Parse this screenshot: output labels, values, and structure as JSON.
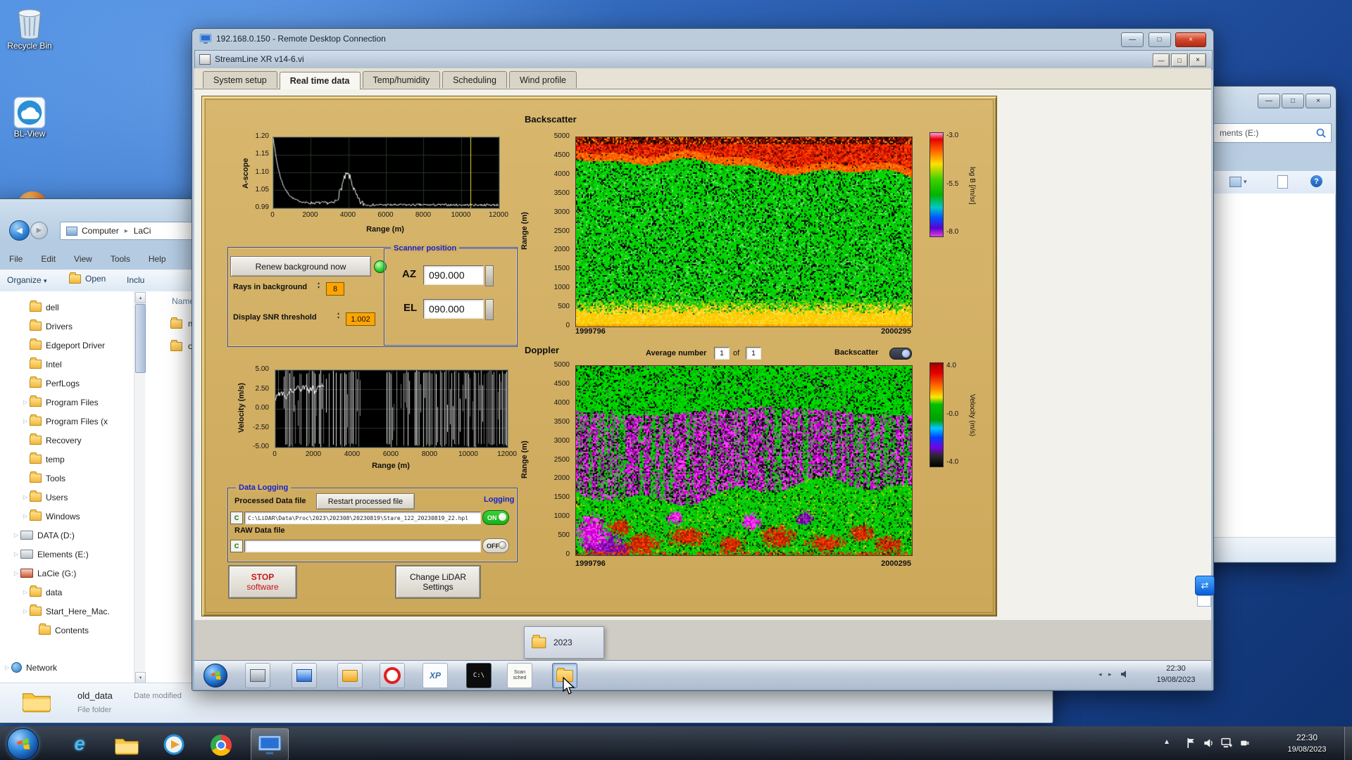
{
  "icons": {
    "close": "×",
    "minimize": "—",
    "maximize": "□",
    "back": "◀",
    "forward": "▶",
    "dropdown": "▾",
    "expand": "▷",
    "breadcrumb_sep": "▸",
    "up_chevron": "▲",
    "left_small": "◂",
    "right_small": "▸",
    "help": "?",
    "spin_up": "▴",
    "spin_down": "▾",
    "swap_arrows": "⇄"
  },
  "colors": {
    "panel_gold": "#d2af62",
    "label_blue": "#1822c8",
    "stop_red": "#c81616",
    "led_green": "#2ecc2e",
    "on_toggle": "#18b018",
    "backscatter_colorbar": [
      "#ff9ce6 0%",
      "#e80000 6%",
      "#ff6a00 18%",
      "#ffe000 30%",
      "#3ed000 45%",
      "#00b400 60%",
      "#00c8c8 72%",
      "#0054ff 82%",
      "#5a00d0 92%",
      "#e040e0 100%"
    ],
    "doppler_colorbar": [
      "#a00000 0%",
      "#e80000 10%",
      "#ff8800 25%",
      "#ffe800 33%",
      "#00c000 40%",
      "#00a000 55%",
      "#00c8ff 63%",
      "#0040ff 72%",
      "#7800e0 82%",
      "#282828 90%",
      "#000000 100%"
    ]
  },
  "desktop": {
    "icons": [
      {
        "label": "Recycle Bin"
      },
      {
        "label": "BL-View"
      }
    ]
  },
  "host_taskbar": {
    "clock_time": "22:30",
    "clock_date": "19/08/2023"
  },
  "explorer": {
    "breadcrumb": {
      "root": "Computer",
      "child": "LaCi"
    },
    "menu": [
      "File",
      "Edit",
      "View",
      "Tools",
      "Help"
    ],
    "toolbar": {
      "organize": "Organize",
      "open": "Open",
      "include": "Inclu"
    },
    "columns": {
      "name": "Name"
    },
    "files_partial": [
      {
        "label": "m"
      },
      {
        "label": "ol"
      }
    ],
    "tree": [
      {
        "label": "dell",
        "icon": "folder",
        "indent": 2
      },
      {
        "label": "Drivers",
        "icon": "folder",
        "indent": 2
      },
      {
        "label": "Edgeport Driver",
        "icon": "folder",
        "indent": 2
      },
      {
        "label": "Intel",
        "icon": "folder",
        "indent": 2
      },
      {
        "label": "PerfLogs",
        "icon": "folder",
        "indent": 2
      },
      {
        "label": "Program Files",
        "icon": "folder",
        "indent": 2,
        "expand": true
      },
      {
        "label": "Program Files (x",
        "icon": "folder",
        "indent": 2,
        "expand": true
      },
      {
        "label": "Recovery",
        "icon": "folder",
        "indent": 2
      },
      {
        "label": "temp",
        "icon": "folder",
        "indent": 2
      },
      {
        "label": "Tools",
        "icon": "folder",
        "indent": 2
      },
      {
        "label": "Users",
        "icon": "folder",
        "indent": 2,
        "expand": true
      },
      {
        "label": "Windows",
        "icon": "folder",
        "indent": 2,
        "expand": true
      },
      {
        "label": "DATA (D:)",
        "icon": "drive",
        "indent": 1,
        "expand": true
      },
      {
        "label": "Elements (E:)",
        "icon": "drive",
        "indent": 1,
        "expand": true
      },
      {
        "label": "LaCie (G:)",
        "icon": "drive-red",
        "indent": 1,
        "expand": true
      },
      {
        "label": "data",
        "icon": "folder",
        "indent": 2,
        "expand": true
      },
      {
        "label": "Start_Here_Mac.",
        "icon": "folder",
        "indent": 2,
        "expand": true
      },
      {
        "label": "Contents",
        "icon": "folder",
        "indent": 3
      },
      {
        "label": "Network",
        "icon": "network",
        "indent": 0,
        "gap": true,
        "expand": true
      }
    ],
    "details": {
      "name": "old_data",
      "modified": "Date modified",
      "type": "File folder"
    }
  },
  "right_window": {
    "search_value": "ments (E:)"
  },
  "rdp": {
    "title": "192.168.0.150 - Remote Desktop Connection",
    "app": {
      "title": "StreamLine XR v14-6.vi",
      "tabs": [
        "System setup",
        "Real time data",
        "Temp/humidity",
        "Scheduling",
        "Wind profile"
      ],
      "active_tab": "Real time data",
      "backscatter_label": "Backscatter",
      "doppler_label": "Doppler",
      "ascope": {
        "ylabel": "A-scope",
        "xlabel": "Range (m)",
        "yticks": [
          "1.20",
          "1.15",
          "1.10",
          "1.05",
          "0.99"
        ],
        "xticks": [
          "0",
          "2000",
          "4000",
          "6000",
          "8000",
          "10000",
          "12000"
        ]
      },
      "velocity": {
        "ylabel": "Velocity (m/s)",
        "xlabel": "Range (m)",
        "yticks": [
          "5.00",
          "2.50",
          "0.00",
          "-2.50",
          "-5.00"
        ],
        "xticks": [
          "0",
          "2000",
          "4000",
          "6000",
          "8000",
          "10000",
          "12000"
        ]
      },
      "heatmap_axis": {
        "ylabel": "Range (m)",
        "yticks": [
          "5000",
          "4500",
          "4000",
          "3500",
          "3000",
          "2500",
          "2000",
          "1500",
          "1000",
          "500",
          "0"
        ],
        "x_start": "1999796",
        "x_end": "2000295"
      },
      "backscatter_colorbar": {
        "ticks": [
          "-3.0",
          "-5.5",
          "-8.0"
        ],
        "label": "log B [/m/sr]"
      },
      "doppler_colorbar": {
        "ticks": [
          "4.0",
          "-0.0",
          "-4.0"
        ],
        "label": "Velocity (m/s)"
      },
      "controls": {
        "renew_button": "Renew background now",
        "rays_label": "Rays in background",
        "rays_value": "8",
        "snr_label": "Display SNR threshold",
        "snr_value": "1.002"
      },
      "scanner": {
        "title": "Scanner position",
        "az_label": "AZ",
        "az_value": "090.000",
        "el_label": "EL",
        "el_value": "090.000"
      },
      "doppler_bar": {
        "avg_label": "Average number",
        "avg_value": "1",
        "of_label": "of",
        "avg_count": "1",
        "toggle_label": "Backscatter"
      },
      "logging": {
        "title": "Data Logging",
        "processed_label": "Processed Data file",
        "restart_button": "Restart processed file",
        "logging_label": "Logging",
        "drive_label": "C",
        "processed_path": "C:\\LiDAR\\Data\\Proc\\2023\\202308\\20230819\\Stare_122_20230819_22.hpl",
        "on_label": "ON",
        "raw_label": "RAW Data file",
        "off_label": "OFF"
      },
      "stop_button": {
        "line1": "STOP",
        "line2": "software"
      },
      "change_button": {
        "line1": "Change LiDAR",
        "line2": "Settings"
      }
    },
    "remote": {
      "folder_window_label": "2023",
      "clock_time": "22:30",
      "clock_date": "19/08/2023",
      "taskbar_icons": [
        {
          "kind": "app-gray",
          "name": "remote-app-icon"
        },
        {
          "kind": "app-blue",
          "name": "remote-monitor-icon"
        },
        {
          "kind": "app-yellow",
          "name": "remote-yellow-app-icon"
        },
        {
          "kind": "ring",
          "name": "remote-stop-icon"
        },
        {
          "kind": "xp",
          "name": "remote-xp-icon",
          "label": "XP"
        },
        {
          "kind": "cmd",
          "name": "remote-cmd-icon",
          "label": "C:\\"
        },
        {
          "kind": "scan",
          "name": "remote-scan-sched-icon",
          "label": "Scan sched"
        },
        {
          "kind": "folder",
          "name": "remote-folder-icon",
          "active": true
        }
      ]
    }
  },
  "chart_data": [
    {
      "type": "line",
      "title": "A-scope",
      "xlabel": "Range (m)",
      "ylabel": "A-scope",
      "xlim": [
        0,
        12000
      ],
      "ylim": [
        0.99,
        1.2
      ],
      "description": "SNR trace: 1.20 at range 0 decaying to ~1.00 by 1500 m, secondary bump to ~1.09 near 4000 m, flat noisy ~1.00 beyond 5000 m, yellow cursor line near 10500 m"
    },
    {
      "type": "line",
      "title": "Velocity",
      "xlabel": "Range (m)",
      "ylabel": "Velocity (m/s)",
      "xlim": [
        0,
        12000
      ],
      "ylim": [
        -5,
        5
      ],
      "description": "dense noisy full-scale velocity returns over 500-4500 m and 5800-12000 m, near-zero trace in first 2500 m, sparse gap 4500-5800 m"
    },
    {
      "type": "heatmap",
      "title": "Backscatter",
      "ylabel": "Range (m)",
      "x_range": [
        1999796,
        2000295
      ],
      "y_range": [
        0,
        5000
      ],
      "colorbar_label": "log B [/m/sr]",
      "colorbar_range": [
        -8.0,
        -3.0
      ],
      "description": "red/orange aerosol layer descending from ~4800 m to ~4000 m across time, speckled green mid-levels, solid yellow strong returns below ~700 m"
    },
    {
      "type": "heatmap",
      "title": "Doppler",
      "ylabel": "Range (m)",
      "x_range": [
        1999796,
        2000295
      ],
      "y_range": [
        0,
        5000
      ],
      "colorbar_label": "Velocity (m/s)",
      "colorbar_range": [
        -4.0,
        4.0
      ],
      "description": "green near-zero velocities above 3700 m, noisy magenta/purple striped band 1500-3700 m, green with red and purple structures below 1500 m"
    }
  ]
}
